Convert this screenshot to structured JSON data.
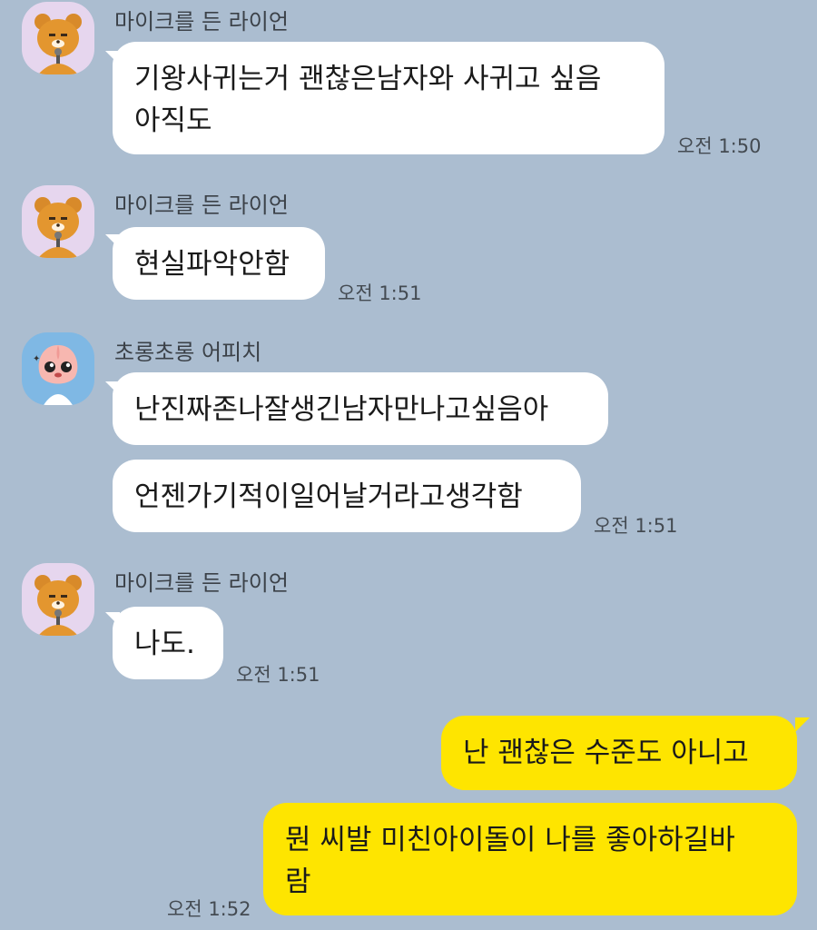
{
  "messages": [
    {
      "sender": "마이크를 든 라이언",
      "avatar_icon": "ryan-microphone-avatar",
      "lines": [
        "기왕사귀는거 괜찮은남자와 사귀고 싶음",
        "아직도"
      ],
      "time": "오전 1:50"
    },
    {
      "sender": "마이크를 든 라이언",
      "avatar_icon": "ryan-microphone-avatar",
      "lines": [
        "현실파악안함"
      ],
      "time": "오전 1:51"
    },
    {
      "sender": "초롱초롱 어피치",
      "avatar_icon": "apeach-avatar",
      "lines_a": [
        "난진짜존나잘생긴남자만나고싶음아"
      ],
      "lines_b": [
        "언젠가기적이일어날거라고생각함"
      ],
      "time": "오전 1:51"
    },
    {
      "sender": "마이크를 든 라이언",
      "avatar_icon": "ryan-microphone-avatar",
      "lines": [
        "나도."
      ],
      "time": "오전 1:51"
    },
    {
      "self": true,
      "lines_a": [
        "난 괜찮은 수준도 아니고"
      ],
      "lines_b": [
        "뭔 씨발 미친아이돌이 나를 좋아하길바",
        "람"
      ],
      "time": "오전 1:52"
    }
  ],
  "colors": {
    "background": "#abbdd0",
    "incoming_bubble": "#ffffff",
    "outgoing_bubble": "#fee500"
  }
}
